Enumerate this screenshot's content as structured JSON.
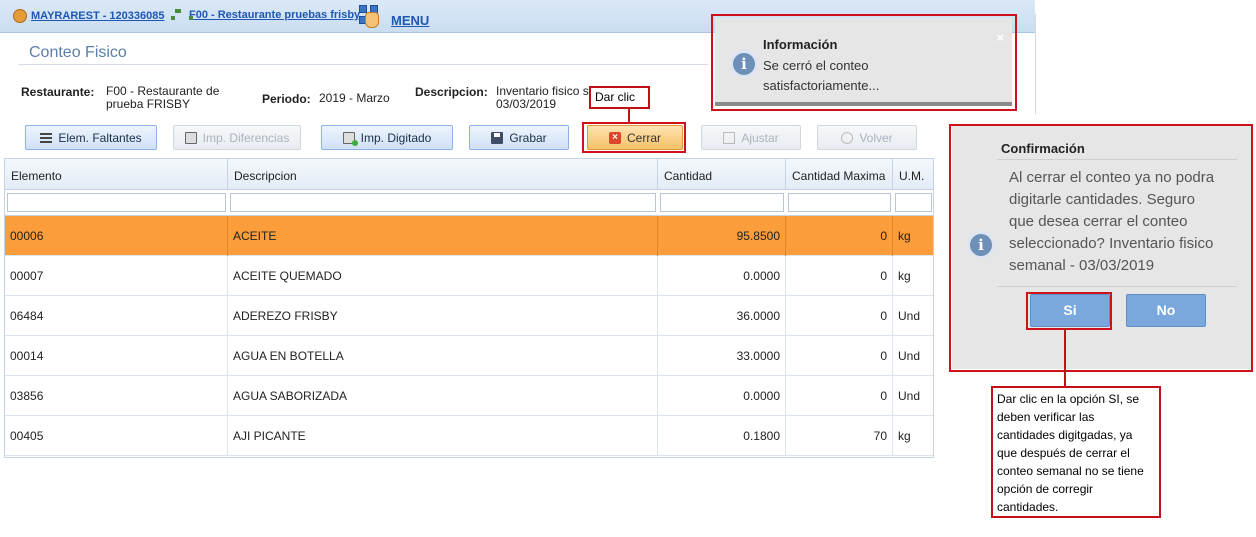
{
  "topbar": {
    "user_link": "MAYRAREST - 120336085",
    "restaurant_link": "F00 - Restaurante pruebas frisby",
    "menu_label": "MENU"
  },
  "page": {
    "title": "Conteo Fisico",
    "restaurante_label": "Restaurante:",
    "restaurante_value": "F00 - Restaurante de prueba FRISBY",
    "periodo_label": "Periodo:",
    "periodo_value": "2019 - Marzo",
    "descripcion_label": "Descripcion:",
    "descripcion_value": "Inventario fisico s 03/03/2019"
  },
  "toolbar": {
    "elem_faltantes": "Elem. Faltantes",
    "imp_diferencias": "Imp. Diferencias",
    "imp_digitado": "Imp. Digitado",
    "grabar": "Grabar",
    "cerrar": "Cerrar",
    "ajustar": "Ajustar",
    "volver": "Volver"
  },
  "grid": {
    "columns": [
      "Elemento",
      "Descripcion",
      "Cantidad",
      "Cantidad Maxima",
      "U.M."
    ],
    "rows": [
      {
        "elemento": "00006",
        "descripcion": "ACEITE",
        "cantidad": "95.8500",
        "cantidad_maxima": "0",
        "um": "kg"
      },
      {
        "elemento": "00007",
        "descripcion": "ACEITE QUEMADO",
        "cantidad": "0.0000",
        "cantidad_maxima": "0",
        "um": "kg"
      },
      {
        "elemento": "06484",
        "descripcion": "ADEREZO FRISBY",
        "cantidad": "36.0000",
        "cantidad_maxima": "0",
        "um": "Und"
      },
      {
        "elemento": "00014",
        "descripcion": "AGUA EN BOTELLA",
        "cantidad": "33.0000",
        "cantidad_maxima": "0",
        "um": "Und"
      },
      {
        "elemento": "03856",
        "descripcion": "AGUA SABORIZADA",
        "cantidad": "0.0000",
        "cantidad_maxima": "0",
        "um": "Und"
      },
      {
        "elemento": "00405",
        "descripcion": "AJI PICANTE",
        "cantidad": "0.1800",
        "cantidad_maxima": "70",
        "um": "kg"
      }
    ]
  },
  "toast": {
    "title": "Información",
    "body": "Se cerró el conteo satisfactoriamente...",
    "close": "×"
  },
  "confirm": {
    "title": "Confirmación",
    "message": "Al cerrar el conteo ya no podra digitarle cantidades. Seguro que desea cerrar el conteo seleccionado? Inventario fisico semanal - 03/03/2019",
    "yes": "Si",
    "no": "No"
  },
  "annotations": {
    "dar_clic": "Dar clic",
    "callout": "Dar clic en la opción SI, se deben verificar las cantidades digitgadas, ya que después de cerrar el conteo semanal no se tiene opción de corregir cantidades."
  },
  "colors": {
    "selected_row": "#fb9d3b",
    "annotation_red": "#d0101a",
    "dialog_button": "#7ba8dc"
  }
}
